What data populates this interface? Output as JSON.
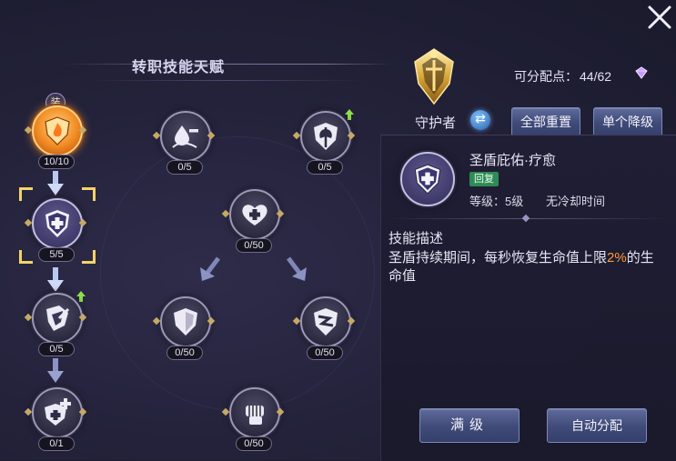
{
  "header": {
    "title": "转职技能天赋"
  },
  "points": {
    "label": "可分配点：",
    "value": "44/62"
  },
  "class_panel": {
    "class_name": "守护者",
    "reset_all_label": "全部重置",
    "single_down_label": "单个降级"
  },
  "skill_detail": {
    "name": "圣盾庇佑·疗愈",
    "tag": "回复",
    "level": "等级：5级",
    "cooldown": "无冷却时间",
    "desc_title": "技能描述",
    "desc_pre": "圣盾持续期间，每秒恢复生命值上限",
    "desc_highlight": "2%",
    "desc_post": "的生命值",
    "max_label": "满级",
    "auto_label": "自动分配"
  },
  "nodes": {
    "n1": {
      "count": "10/10",
      "icon": "shield-flame-icon",
      "badge": "装"
    },
    "n2": {
      "count": "5/5",
      "icon": "shield-plus-icon"
    },
    "n3": {
      "count": "0/5",
      "icon": "shield-wing-icon"
    },
    "n4": {
      "count": "0/1",
      "icon": "shield-cross-icon"
    },
    "n5": {
      "count": "0/5",
      "icon": "water-drop-minus-icon"
    },
    "n6": {
      "count": "0/50",
      "icon": "heart-plus-icon"
    },
    "n7": {
      "count": "0/50",
      "icon": "shield-icon"
    },
    "n8": {
      "count": "0/50",
      "icon": "fist-icon"
    },
    "n9": {
      "count": "0/5",
      "icon": "shield-axe-icon"
    },
    "n10": {
      "count": "0/50",
      "icon": "shield-cracked-icon"
    }
  },
  "colors": {
    "accent": "#f3d36a",
    "highlight": "#ff9a3c",
    "tag_green": "#2f8a55"
  }
}
